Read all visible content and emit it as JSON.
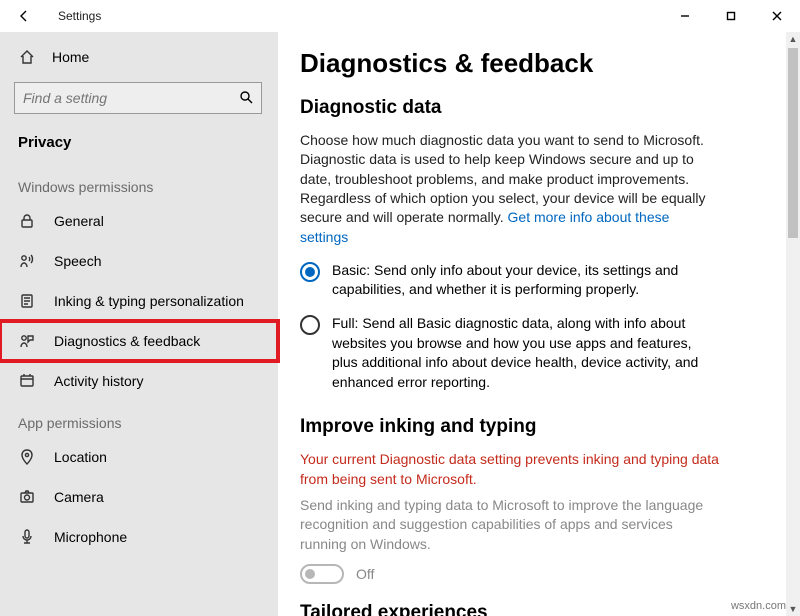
{
  "window": {
    "title": "Settings",
    "min": "—",
    "max": "☐",
    "close": "✕"
  },
  "sidebar": {
    "home": "Home",
    "search_placeholder": "Find a setting",
    "current": "Privacy",
    "groups": [
      {
        "label": "Windows permissions",
        "items": [
          {
            "label": "General",
            "icon": "lock"
          },
          {
            "label": "Speech",
            "icon": "speech"
          },
          {
            "label": "Inking & typing personalization",
            "icon": "clipboard"
          },
          {
            "label": "Diagnostics & feedback",
            "icon": "feedback",
            "highlight": true
          },
          {
            "label": "Activity history",
            "icon": "history"
          }
        ]
      },
      {
        "label": "App permissions",
        "items": [
          {
            "label": "Location",
            "icon": "location"
          },
          {
            "label": "Camera",
            "icon": "camera"
          },
          {
            "label": "Microphone",
            "icon": "mic"
          }
        ]
      }
    ]
  },
  "page": {
    "title": "Diagnostics & feedback",
    "diag": {
      "heading": "Diagnostic data",
      "intro": "Choose how much diagnostic data you want to send to Microsoft. Diagnostic data is used to help keep Windows secure and up to date, troubleshoot problems, and make product improvements. Regardless of which option you select, your device will be equally secure and will operate normally. ",
      "link": "Get more info about these settings",
      "options": {
        "basic": "Basic: Send only info about your device, its settings and capabilities, and whether it is performing properly.",
        "full": "Full: Send all Basic diagnostic data, along with info about websites you browse and how you use apps and features, plus additional info about device health, device activity, and enhanced error reporting."
      },
      "selected": "basic"
    },
    "inking": {
      "heading": "Improve inking and typing",
      "warning": "Your current Diagnostic data setting prevents inking and typing data from being sent to Microsoft.",
      "desc": "Send inking and typing data to Microsoft to improve the language recognition and suggestion capabilities of apps and services running on Windows.",
      "state": "Off"
    },
    "tailored": {
      "heading": "Tailored experiences"
    }
  },
  "watermark": "wsxdn.com"
}
